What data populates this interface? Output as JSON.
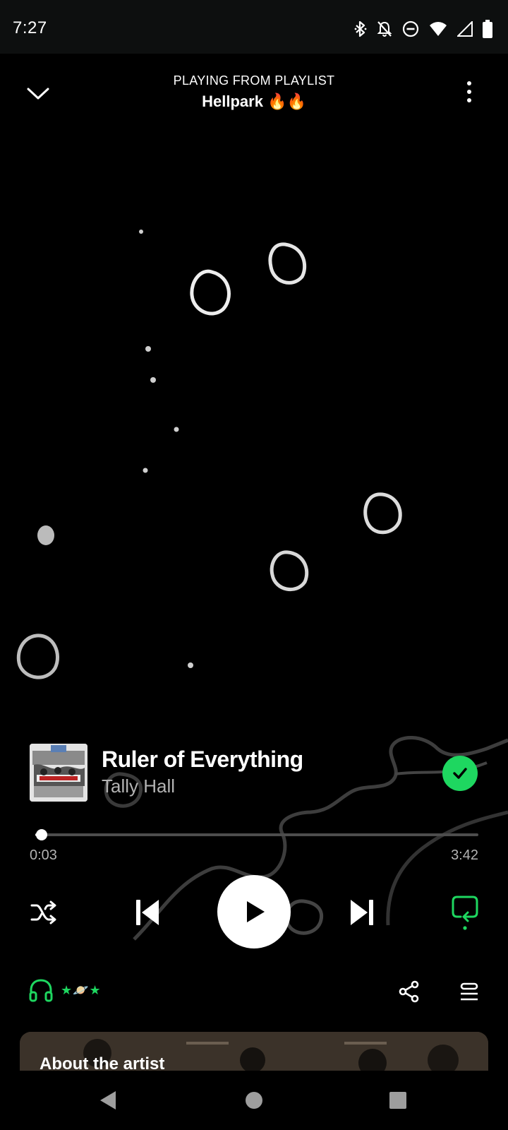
{
  "status_bar": {
    "time": "7:27",
    "icons": [
      "bluetooth-icon",
      "notifications-off-icon",
      "do-not-disturb-icon",
      "wifi-icon",
      "cell-signal-icon",
      "battery-icon"
    ]
  },
  "header": {
    "subtitle": "PLAYING FROM PLAYLIST",
    "playlist_name": "Hellpark 🔥🔥"
  },
  "track": {
    "title": "Ruler of Everything",
    "artist": "Tally Hall",
    "liked": true
  },
  "playback": {
    "elapsed": "0:03",
    "total": "3:42",
    "progress": 0.014,
    "shuffle": false,
    "repeat": true,
    "playing": false
  },
  "device": {
    "label": "★🪐★"
  },
  "about": {
    "title": "About the artist"
  },
  "colors": {
    "accent": "#1ed760",
    "background": "#000000",
    "secondary_text": "#b3b3b3",
    "status_bar": "#0d0f0f"
  }
}
